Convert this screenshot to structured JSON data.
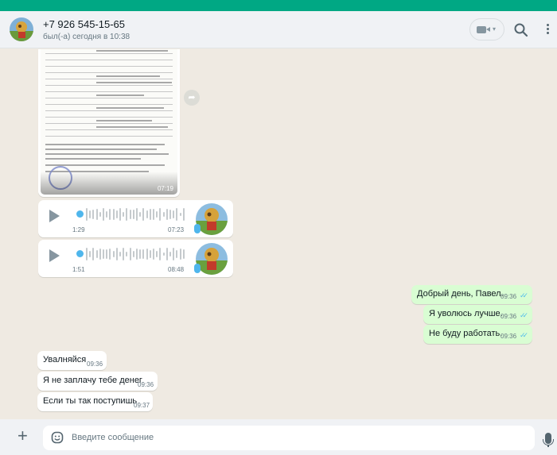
{
  "colors": {
    "top_accent": "#00a884",
    "incoming_bubble": "#ffffff",
    "outgoing_bubble": "#d9fdd3",
    "read_ticks": "#53bdeb",
    "chat_background": "#efeae2"
  },
  "header": {
    "contact_name": "+7 926 545-15-65",
    "status": "был(-а) сегодня в 10:38",
    "icons": {
      "avatar": "contact-avatar",
      "video": "video-camera-icon",
      "search": "search-icon",
      "menu": "kebab-menu-icon"
    }
  },
  "messages": {
    "image": {
      "time": "07:19",
      "icon": "forward-icon"
    },
    "voice": [
      {
        "duration": "1:29",
        "time": "07:23"
      },
      {
        "duration": "1:51",
        "time": "08:48"
      }
    ],
    "outgoing": [
      {
        "text": "Добрый день, Павел.",
        "time": "09:36",
        "status": "✓✓"
      },
      {
        "text": "Я уволюсь лучше.",
        "time": "09:36",
        "status": "✓✓"
      },
      {
        "text": "Не буду работать.",
        "time": "09:36",
        "status": "✓✓"
      }
    ],
    "incoming": [
      {
        "text": "Увалняйся",
        "time": "09:36"
      },
      {
        "text": "Я не заплачу тебе денег",
        "time": "09:36"
      },
      {
        "text": "Если ты так поступишь",
        "time": "09:37"
      }
    ]
  },
  "composer": {
    "placeholder": "Введите сообщение",
    "icons": {
      "attach": "plus-icon",
      "emoji": "emoji-icon",
      "mic": "microphone-icon"
    }
  }
}
